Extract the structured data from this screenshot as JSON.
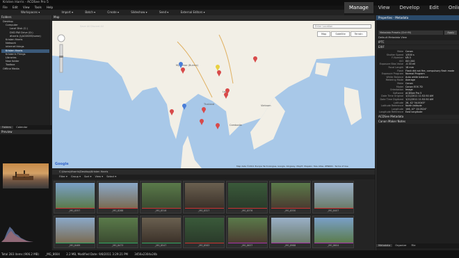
{
  "window_title": "Kristen Harris - ACDSee Pro 5",
  "menu": [
    "File",
    "Edit",
    "View",
    "Tools",
    "Help"
  ],
  "modes": [
    {
      "label": "Manage",
      "active": true
    },
    {
      "label": "View",
      "active": false
    },
    {
      "label": "Develop",
      "active": false
    },
    {
      "label": "Edit",
      "active": false
    },
    {
      "label": "Online",
      "active": false
    }
  ],
  "toolbar": [
    "Workspaces ▾",
    "Import ▾",
    "Batch ▾",
    "Create ▾",
    "Slideshow ▾",
    "Send ▾",
    "External Editors ▾"
  ],
  "folders": {
    "header": "Folders",
    "items": [
      {
        "label": "Desktop",
        "selected": false
      },
      {
        "label": "Computer",
        "selected": false
      },
      {
        "label": "Local Disk (C:)",
        "selected": false
      },
      {
        "label": "DVD RW Drive (D:)",
        "selected": false
      },
      {
        "label": "dharris (\\\\ACDSEE\\home)",
        "selected": false
      },
      {
        "label": "Kristen Harris",
        "selected": false
      },
      {
        "label": "Network",
        "selected": false
      },
      {
        "label": "internet things",
        "selected": false
      },
      {
        "label": "Kristen Harris",
        "selected": true
      },
      {
        "label": "Kristen's Things",
        "selected": false
      },
      {
        "label": "Libraries",
        "selected": false
      },
      {
        "label": "New folder",
        "selected": false
      },
      {
        "label": "Toolbox",
        "selected": false
      },
      {
        "label": "Offline Media",
        "selected": false
      }
    ]
  },
  "left_tabs": [
    "Folders",
    "Calendar"
  ],
  "preview": {
    "header": "Preview"
  },
  "map": {
    "header": "Map",
    "tabs": "Save All   Discard All",
    "search_placeholder": "Enter Location",
    "buttons": [
      "Map",
      "Satellite",
      "Terrain"
    ],
    "labels": {
      "myanmar": "Myanmar (Burma)",
      "laos": "Laos",
      "thailand": "Thailand",
      "cambodia": "Cambodia",
      "vietnam": "Vietnam",
      "hanoi": "Hanoi",
      "bangkok": "Bangkok"
    },
    "attribution": "Map data ©2011 Europa Technologies, Google, Kingway, MapIT, Mapabc, Tele Atlas, ZENRIN - Terms of Use",
    "google": "Google"
  },
  "path": "C:\\Users\\dharris\\Desktop\\Kristen Harris",
  "filterbar": [
    "Filter ▾",
    "Group ▾",
    "Sort ▾",
    "View ▾",
    "Select ▾"
  ],
  "thumbnails": [
    {
      "label": "_MG_8357",
      "bar": "#c33"
    },
    {
      "label": "_MG_8288",
      "bar": "#c33"
    },
    {
      "label": "_MG_8316",
      "bar": "#c33"
    },
    {
      "label": "_MG_8327",
      "bar": "#c33"
    },
    {
      "label": "_MG_8376",
      "bar": "#c33"
    },
    {
      "label": "_MG_8330",
      "bar": "#c33"
    },
    {
      "label": "_MG_8407",
      "bar": "#c33"
    },
    {
      "label": "_MG_8469",
      "bar": "#3a6"
    },
    {
      "label": "_MG_8473",
      "bar": "#3a6"
    },
    {
      "label": "_MG_8547",
      "bar": "#3a6"
    },
    {
      "label": "_MG_8583",
      "bar": "#c33"
    },
    {
      "label": "_MG_8637",
      "bar": "#a3a"
    },
    {
      "label": "_MG_8988",
      "bar": "#a3a"
    },
    {
      "label": "_MG_8604",
      "bar": "#a3a"
    }
  ],
  "properties": {
    "header": "Properties - Metadata",
    "preset": "Metadata Presets (Ctrl+M)",
    "apply": "Apply",
    "view": "Default Metadata View",
    "sections": [
      "IPTC",
      "EXIF"
    ],
    "exif": [
      {
        "k": "Make",
        "v": "Canon"
      },
      {
        "k": "Shutter Speed",
        "v": "1/500 s"
      },
      {
        "k": "F-Number",
        "v": "f/6.3"
      },
      {
        "k": "ISO",
        "v": "ISO 200"
      },
      {
        "k": "Exposure Bias Value",
        "v": "-0.33 eV"
      },
      {
        "k": "Focal Length",
        "v": "18 mm"
      },
      {
        "k": "Flash",
        "v": "Flash did not fire, compulsory flash mode"
      },
      {
        "k": "Exposure Program",
        "v": "Normal Program"
      },
      {
        "k": "White Balance",
        "v": "Auto white balance"
      },
      {
        "k": "Metering Mode",
        "v": "Average"
      },
      {
        "k": "Make",
        "v": "Canon"
      },
      {
        "k": "Model",
        "v": "Canon EOS 7D"
      },
      {
        "k": "Orientation",
        "v": "Image"
      },
      {
        "k": "Software",
        "v": "ACDSee Pro 5"
      },
      {
        "k": "Date Time Original",
        "v": "1/11/2011 11:52:50 AM"
      },
      {
        "k": "Date Time Digitized",
        "v": "1/11/2011 11:52:50 AM"
      },
      {
        "k": "Latitude",
        "v": "26, 42' 54.0043\""
      },
      {
        "k": "Latitude Reference",
        "v": "North latitude"
      },
      {
        "k": "Longitude",
        "v": "106, 47' 13.0524\""
      },
      {
        "k": "Longitude Reference",
        "v": "East longitude"
      }
    ],
    "more_sections": [
      "ACDSee Metadata",
      "Canon Maker Notes"
    ],
    "bottom_tabs": [
      "Metadata",
      "Organize",
      "File"
    ]
  },
  "status": {
    "total": "Total 283 items  (906.2 MB)",
    "file": "_MG_8604",
    "size": "2.2 MB, Modified Date: 9/8/2011 3:29:21 PM",
    "dims": "3456x2304x24b"
  },
  "colors": {
    "accent": "#3b5a7a",
    "map_water": "#a8c8e8",
    "map_land": "#f2efe6"
  }
}
